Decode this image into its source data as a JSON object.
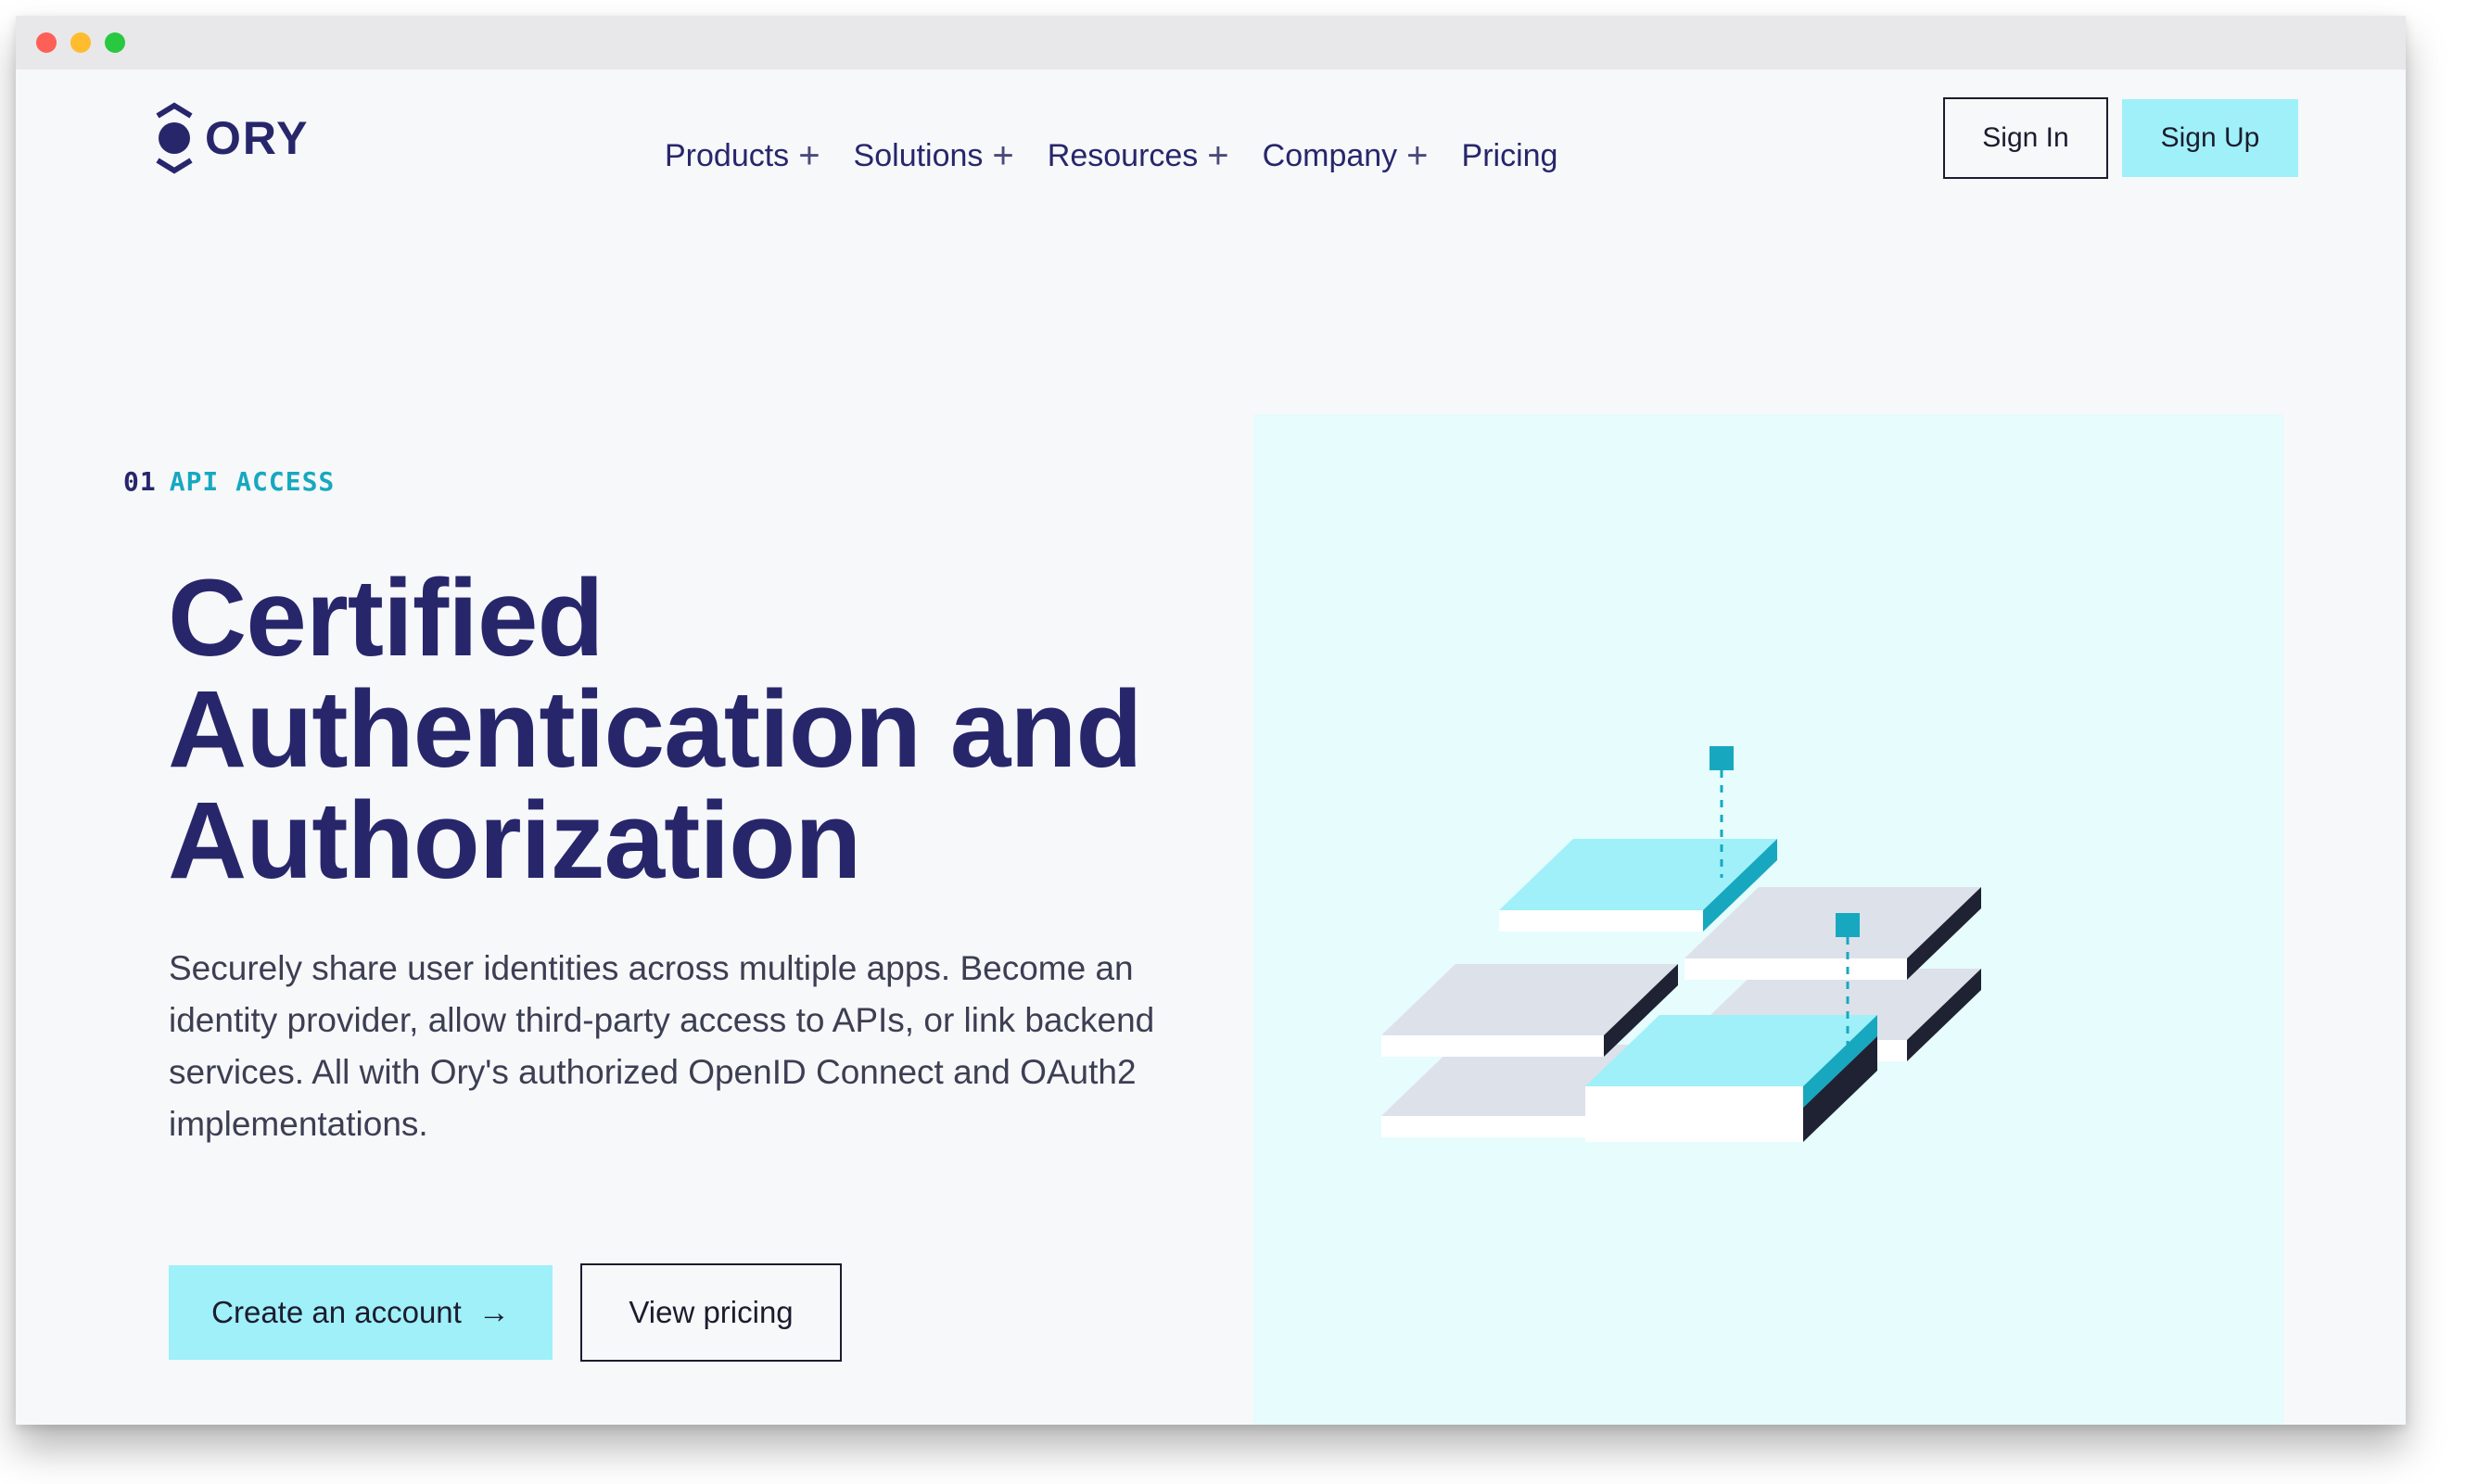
{
  "nav": {
    "logo_text": "ORY",
    "items": [
      {
        "label": "Products",
        "has_submenu": true
      },
      {
        "label": "Solutions",
        "has_submenu": true
      },
      {
        "label": "Resources",
        "has_submenu": true
      },
      {
        "label": "Company",
        "has_submenu": true
      },
      {
        "label": "Pricing",
        "has_submenu": false
      }
    ],
    "submenu_icon": "+",
    "sign_in_label": "Sign In",
    "sign_up_label": "Sign Up"
  },
  "hero": {
    "eyebrow_number": "01",
    "eyebrow_label": "API ACCESS",
    "headline": "Certified Authentication and Authorization",
    "description": "Securely share user identities across multiple apps. Become an identity provider, allow third-party access to APIs, or link backend services. All with Ory's authorized OpenID Connect and OAuth2 implementations.",
    "primary_cta": "Create an account",
    "primary_cta_icon": "→",
    "secondary_cta": "View pricing"
  },
  "colors": {
    "brand_navy": "#28266b",
    "accent_cyan": "#9ff0f9",
    "accent_teal": "#17a8c0",
    "panel_bg": "#e6fcfd",
    "page_bg": "#f6f8fa"
  },
  "icons": {
    "logo": "ory-hexagon-logo",
    "illustration": "isometric-layered-tiles-illustration"
  }
}
